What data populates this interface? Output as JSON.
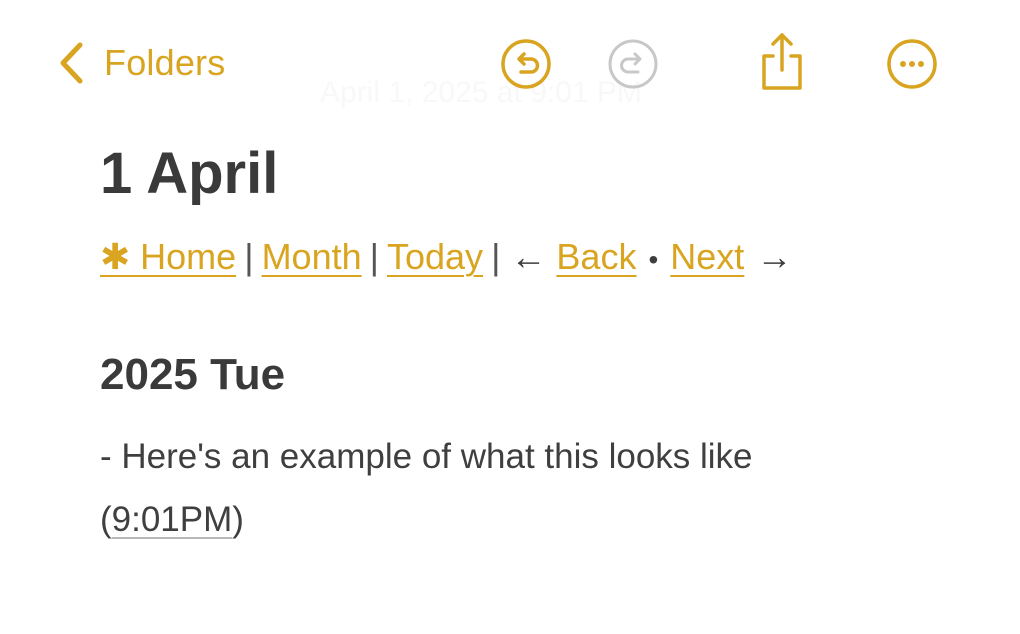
{
  "colors": {
    "accent": "#d9a520",
    "text": "#3d3d3d",
    "disabled": "#c8c8c8",
    "background": "#ffffff"
  },
  "toolbar": {
    "back_label": "Folders",
    "back_icon": "chevron-left-icon",
    "undo_icon": "undo-icon",
    "redo_icon": "redo-icon",
    "share_icon": "share-icon",
    "more_icon": "more-icon"
  },
  "ghost_header": "April 1, 2025 at 9:01 PM",
  "note": {
    "title": "1 April",
    "nav": {
      "home": "✱ Home",
      "month": "Month",
      "today": "Today",
      "back_arrow": "←",
      "back": "Back",
      "dot": "•",
      "next": "Next",
      "next_arrow": "→",
      "separator": "|"
    },
    "subheading": "2025 Tue",
    "entry": {
      "text": "- Here's an example of what this looks like",
      "time_open": "(",
      "time": "9:01PM",
      "time_close": ")"
    }
  }
}
